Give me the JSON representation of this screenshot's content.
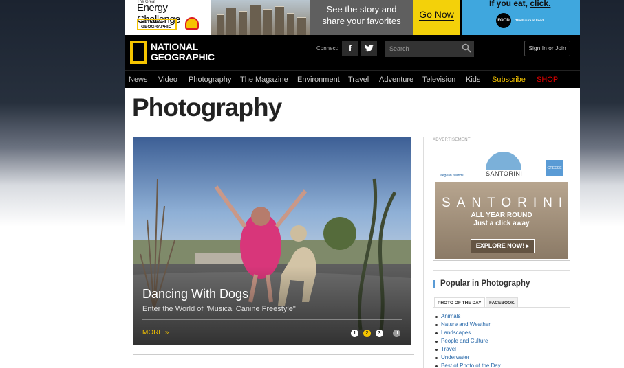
{
  "banner": {
    "great": "The Great",
    "energy_challenge": "Energy Challenge",
    "ng_small": "NATIONAL GEOGRAPHIC",
    "story_line1": "See the story and",
    "story_line2": "share your favorites",
    "go_now": "Go Now",
    "food_line_a": "If you eat, ",
    "food_line_b": "click.",
    "food_logo": "FOOD",
    "food_tag": "The Future of Food"
  },
  "header": {
    "logo_line1": "NATIONAL",
    "logo_line2": "GEOGRAPHIC",
    "connect": "Connect:",
    "facebook": "f",
    "twitter": "t",
    "search_placeholder": "Search",
    "sign_in": "Sign In or Join"
  },
  "nav": {
    "items": [
      "News",
      "Video",
      "Photography",
      "The Magazine",
      "Environment",
      "Travel",
      "Adventure",
      "Television",
      "Kids",
      "Subscribe",
      "SHOP"
    ]
  },
  "page": {
    "title": "Photography"
  },
  "hero": {
    "caption": "Dancing With Dogs",
    "subtitle": "Enter the World of \"Musical Canine Freestyle\"",
    "more": "MORE »",
    "dots": [
      "1",
      "2",
      "3",
      "II"
    ],
    "active_slide": 2
  },
  "sidebar": {
    "advertisement_label": "ADVERTISEMENT",
    "ad": {
      "islands": "aegean islands",
      "santorini_small": "SANTORINI",
      "the_one": "THE ONE",
      "flag": "GREECE",
      "santorini_big": "SANTORINI",
      "year_round": "ALL YEAR ROUND",
      "click_away": "Just a click away",
      "explore": "EXPLORE NOW!  ▸"
    },
    "popular_title": "Popular in Photography",
    "tabs": [
      "PHOTO OF THE DAY",
      "FACEBOOK"
    ],
    "links": [
      "Animals",
      "Nature and Weather",
      "Landscapes",
      "People and Culture",
      "Travel",
      "Underwater",
      "Best of Photo of the Day"
    ]
  },
  "colors": {
    "brand_yellow": "#f5c400",
    "link_blue": "#2466a8",
    "subscribe": "#f5c400",
    "shop": "#e60000"
  }
}
